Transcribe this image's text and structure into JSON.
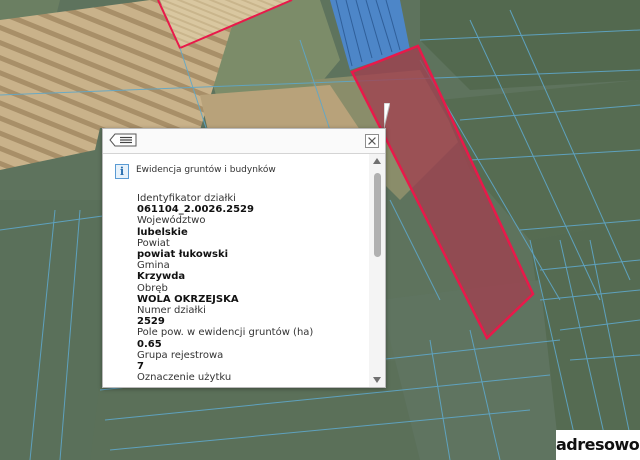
{
  "popup": {
    "section_title": "Ewidencja gruntów i budynków",
    "info_glyph": "i",
    "attributes": [
      {
        "label": "Identyfikator działki",
        "value": "061104_2.0026.2529"
      },
      {
        "label": "Województwo",
        "value": "lubelskie"
      },
      {
        "label": "Powiat",
        "value": "powiat łukowski"
      },
      {
        "label": "Gmina",
        "value": "Krzywda"
      },
      {
        "label": "Obręb",
        "value": "WOLA OKRZEJSKA"
      },
      {
        "label": "Numer działki",
        "value": "2529"
      },
      {
        "label": "Pole pow. w ewidencji gruntów (ha)",
        "value": "0.65"
      },
      {
        "label": "Grupa rejestrowa",
        "value": "7"
      },
      {
        "label": "Oznaczenie użytku",
        "value": ""
      }
    ],
    "icons": {
      "menu": "list-menu-icon",
      "close": "close-icon",
      "info": "info-icon",
      "scroll_up": "arrow-up-icon",
      "scroll_down": "arrow-down-icon"
    }
  },
  "logo": {
    "name": "adresowo",
    "dot": ".",
    "tld": "pl"
  },
  "colors": {
    "parcel_outline": "#e8194a",
    "parcel_fill": "#a0404f",
    "popup_border": "#b9b9b9",
    "info_icon": "#5a9bd4"
  }
}
